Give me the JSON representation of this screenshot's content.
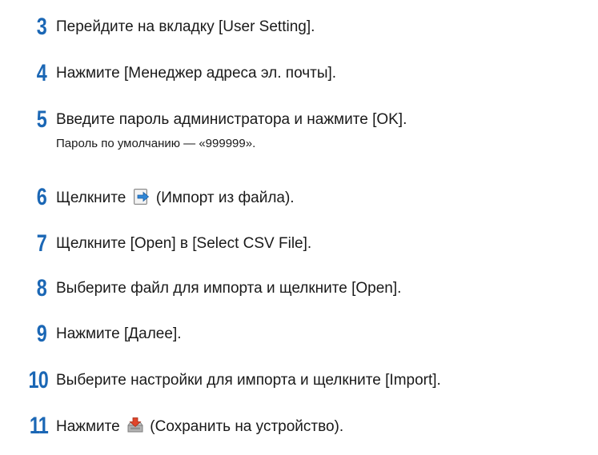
{
  "steps": [
    {
      "num": "3",
      "before": "Перейдите на вкладку [User Setting].",
      "icon": "",
      "after": ""
    },
    {
      "num": "4",
      "before": "Нажмите [Менеджер адреса эл. почты].",
      "icon": "",
      "after": ""
    },
    {
      "num": "5",
      "before": "Введите пароль администратора и нажмите [OK].",
      "icon": "",
      "after": "",
      "note": "Пароль по умолчанию — «999999»."
    },
    {
      "num": "6",
      "before": "Щелкните",
      "icon": "import-from-file-icon",
      "after": "(Импорт из файла)."
    },
    {
      "num": "7",
      "before": "Щелкните [Open] в [Select CSV File].",
      "icon": "",
      "after": ""
    },
    {
      "num": "8",
      "before": "Выберите файл для импорта и щелкните [Open].",
      "icon": "",
      "after": ""
    },
    {
      "num": "9",
      "before": "Нажмите [Далее].",
      "icon": "",
      "after": ""
    },
    {
      "num": "10",
      "before": "Выберите настройки для импорта и щелкните [Import].",
      "icon": "",
      "after": ""
    },
    {
      "num": "11",
      "before": "Нажмите",
      "icon": "save-to-device-icon",
      "after": "(Сохранить на устройство)."
    }
  ],
  "colors": {
    "step_number": "#1b67b5",
    "text": "#1a1a1a"
  }
}
